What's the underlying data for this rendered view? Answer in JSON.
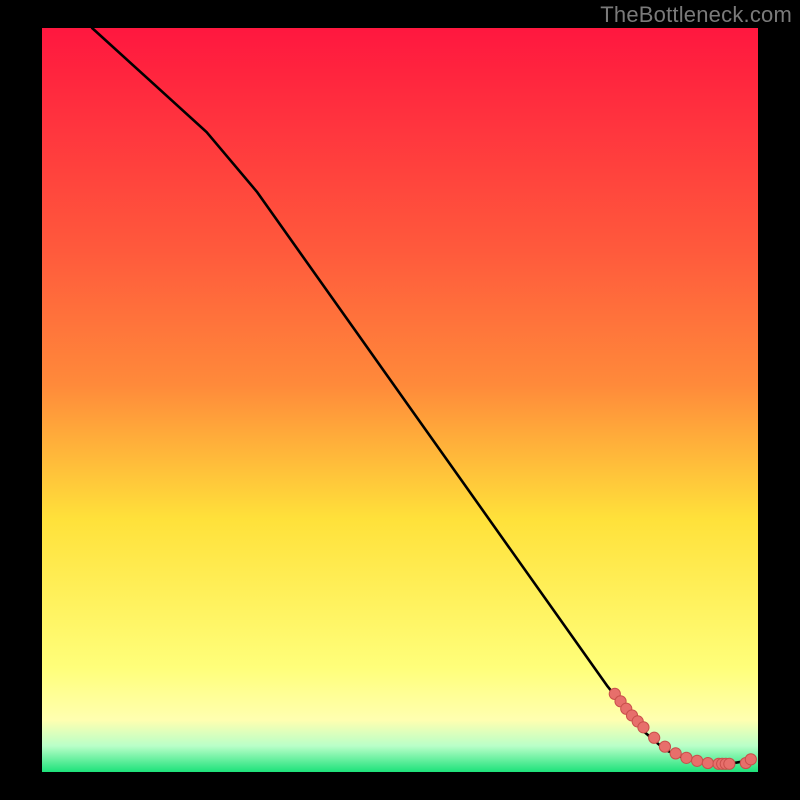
{
  "watermark": "TheBottleneck.com",
  "colors": {
    "frame": "#000000",
    "watermark": "#7a7a7a",
    "curve": "#000000",
    "marker_fill": "#e76f6b",
    "marker_stroke": "#c94f4b",
    "gradient_top": "#ff173f",
    "gradient_mid_upper": "#ff8a3a",
    "gradient_mid": "#ffe13a",
    "gradient_pale": "#ffffb0",
    "gradient_bottom": "#1de27a"
  },
  "chart_data": {
    "type": "line",
    "title": "",
    "xlabel": "",
    "ylabel": "",
    "xlim": [
      0,
      100
    ],
    "ylim": [
      0,
      100
    ],
    "grid": false,
    "series": [
      {
        "name": "curve",
        "x": [
          7,
          15,
          23,
          30,
          37,
          44,
          51,
          58,
          65,
          72,
          79,
          84,
          87,
          90,
          93,
          96,
          99
        ],
        "y": [
          100,
          93,
          86,
          78,
          68.5,
          59,
          49.5,
          40,
          30.5,
          21,
          11.5,
          5.5,
          3,
          1.7,
          1.2,
          1.1,
          1.6
        ]
      }
    ],
    "markers": {
      "name": "points",
      "x": [
        80.0,
        80.8,
        81.6,
        82.4,
        83.2,
        84.0,
        85.5,
        87.0,
        88.5,
        90.0,
        91.5,
        93.0,
        94.5,
        95.0,
        95.5,
        96.0,
        98.3,
        99.0
      ],
      "y": [
        10.5,
        9.5,
        8.5,
        7.6,
        6.8,
        6.0,
        4.6,
        3.4,
        2.5,
        1.9,
        1.5,
        1.2,
        1.1,
        1.1,
        1.1,
        1.1,
        1.2,
        1.7
      ]
    }
  }
}
